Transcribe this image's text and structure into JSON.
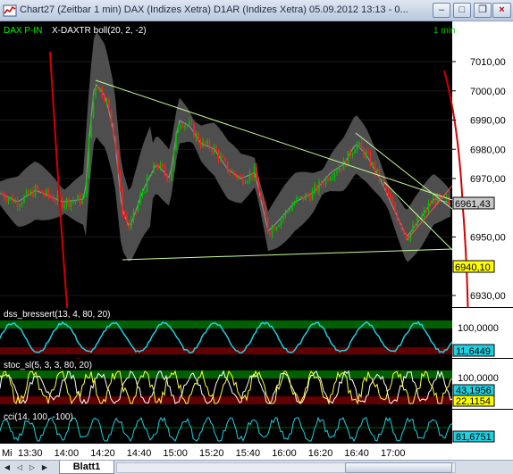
{
  "window": {
    "title": "Chart27 (Zeitbar 1 min)  DAX (Indizes Xetra) D1AR (Indizes Xetra) 05.09.2012 13:13 - 0...",
    "buttons": [
      "minimize",
      "maximize",
      "restore",
      "close"
    ]
  },
  "price_panel": {
    "legend_instrument": "DAX P-IN",
    "legend_indicator": "X-DAXTR boll(20, 2, -2)",
    "interval": "1 min",
    "axis_labels": [
      "7010,00",
      "7000,00",
      "6990,00",
      "6980,00",
      "6970,00",
      "6950,00",
      "6930,00"
    ],
    "axis_values": [
      7010,
      7000,
      6990,
      6980,
      6970,
      6950,
      6930
    ],
    "current_price_tag": "6961,43",
    "level_tag": "6940,10",
    "colors": {
      "up": "#00c000",
      "down": "#ff2020",
      "band": "#7a7a7a",
      "trendline": "#c8ff96",
      "annotation": "#d40000",
      "price_tag_bg": "#ffff00"
    }
  },
  "dss_panel": {
    "label": "dss_bressert(13, 4, 80, 20)",
    "axis_label": "100,0000",
    "value_tag": "11,6449",
    "colors": {
      "line": "#20d0e0",
      "upper_zone": "#006000",
      "lower_zone": "#600000"
    }
  },
  "stoch_panel": {
    "label": "stoc_sl(5, 3, 3, 80, 20)",
    "axis_label": "100,0000",
    "value_tag_1": "43,1956",
    "value_tag_2": "22,1154",
    "colors": {
      "k_line": "#ffff40",
      "d_line": "#ffffff",
      "upper_zone": "#006000",
      "lower_zone": "#600000"
    }
  },
  "cci_panel": {
    "label": "cci(14, 100, -100)",
    "value_tag": "81,6751",
    "colors": {
      "line": "#20d0e0"
    }
  },
  "time_axis": {
    "day_label": "Mi",
    "labels": [
      "13:30",
      "14:00",
      "14:20",
      "14:40",
      "15:00",
      "15:20",
      "15:40",
      "16:00",
      "16:20",
      "16:40",
      "17:00"
    ]
  },
  "sheet_tabs": {
    "active": "Blatt1"
  }
}
